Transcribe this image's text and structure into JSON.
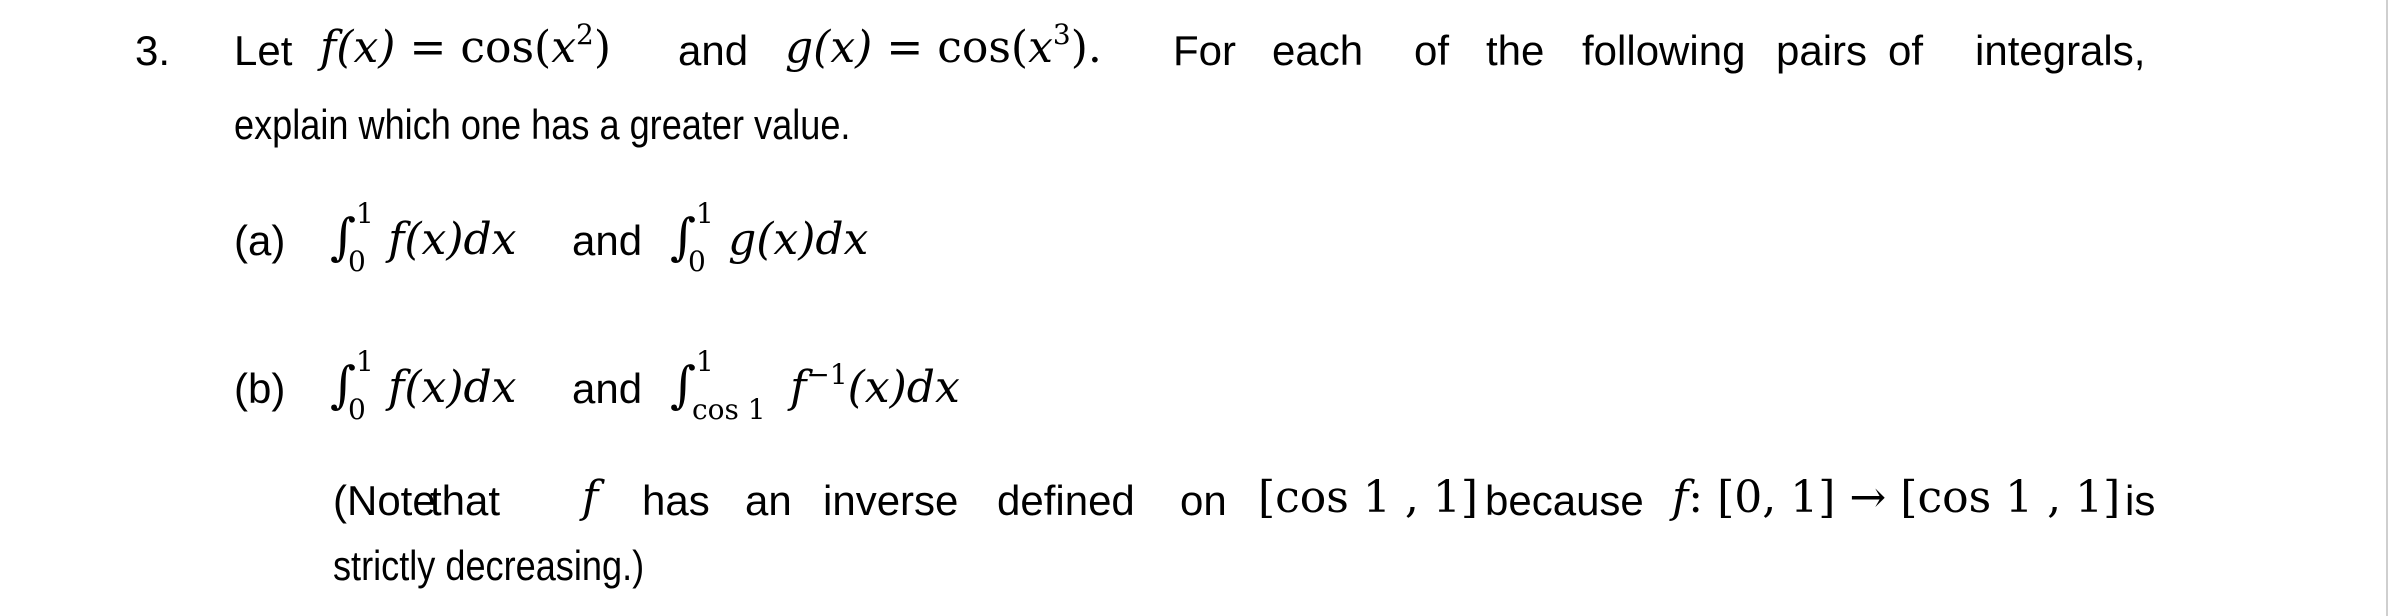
{
  "problem": {
    "number": "3.",
    "intro": {
      "let": "Let",
      "f_def": {
        "lhs": "f(x)",
        "eq": "=",
        "func": "cos",
        "arg": "x",
        "exp": "2"
      },
      "and": "and",
      "g_def": {
        "lhs": "g(x)",
        "eq": "=",
        "func": "cos",
        "arg": "x",
        "exp": "3",
        "end": "."
      },
      "rest_words": [
        "For",
        "each",
        "of",
        "the",
        "following",
        "pairs",
        "of",
        "integrals,"
      ],
      "line2": "explain which one has a greater value."
    },
    "parts": [
      {
        "label": "(a)",
        "left_integral": {
          "upper": "1",
          "lower": "0",
          "integrand": "f(x)dx"
        },
        "connector": "and",
        "right_integral": {
          "upper": "1",
          "lower": "0",
          "integrand": "g(x)dx"
        }
      },
      {
        "label": "(b)",
        "left_integral": {
          "upper": "1",
          "lower": "0",
          "integrand": "f(x)dx"
        },
        "connector": "and",
        "right_integral": {
          "upper": "1",
          "lower": "cos 1",
          "integrand_func": "f",
          "integrand_exp": "−1",
          "integrand_rest": "(x)dx"
        }
      }
    ],
    "note": {
      "words": [
        "(Note",
        "that"
      ],
      "f": "f",
      "words2": [
        "has",
        "an",
        "inverse",
        "defined",
        "on"
      ],
      "interval1": "[cos 1 , 1]",
      "because": "because",
      "map_f": "f",
      "map_domain": ": [0, 1]",
      "arrow": "→",
      "interval2": "[cos 1 , 1]",
      "is": "is",
      "line2": "strictly decreasing.)"
    }
  }
}
